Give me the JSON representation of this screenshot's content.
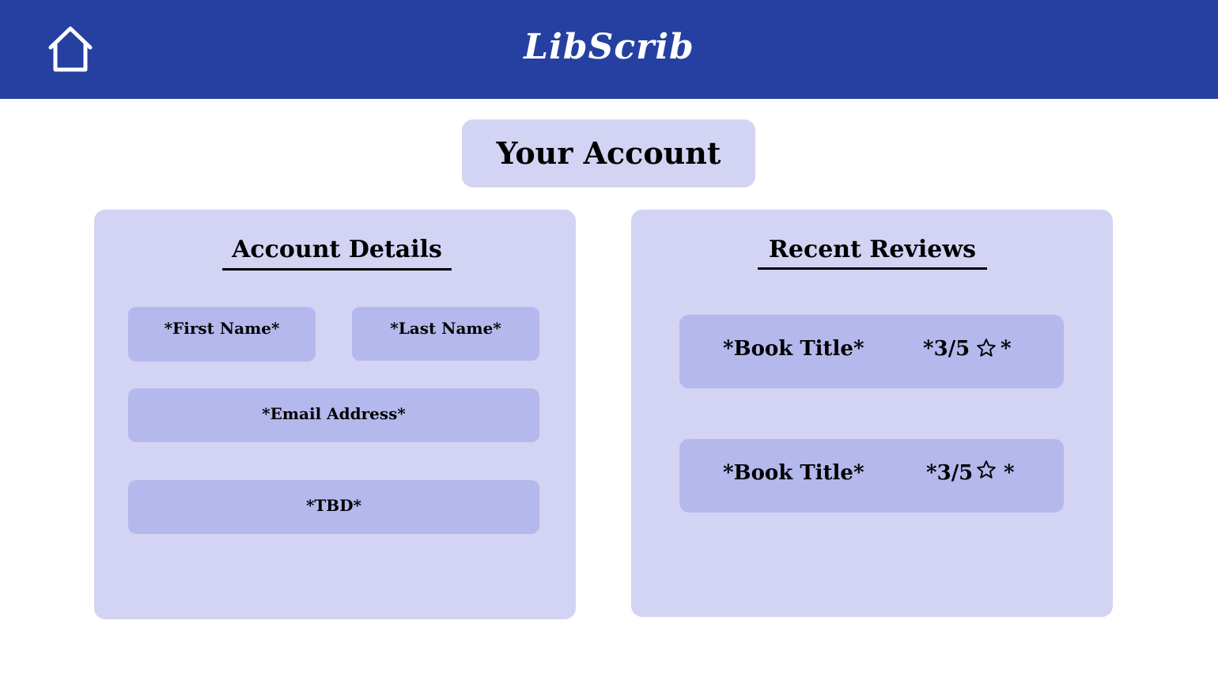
{
  "header": {
    "brand": "LibScrib",
    "home_icon": "home-icon"
  },
  "page": {
    "title": "Your Account"
  },
  "account_details": {
    "heading": "Account Details",
    "first_name": "*First Name*",
    "last_name": "*Last Name*",
    "email": "*Email Address*",
    "tbd": "*TBD*"
  },
  "recent_reviews": {
    "heading": "Recent Reviews",
    "items": [
      {
        "title": "*Book Title*",
        "rating": "*3/5",
        "star_icon": "star-outline-icon",
        "suffix": "*"
      },
      {
        "title": "*Book Title*",
        "rating": "*3/5",
        "star_icon": "star-outline-icon",
        "suffix": "*"
      }
    ]
  },
  "colors": {
    "header_bg": "#2540a0",
    "panel_bg": "#d3d3f3",
    "field_bg": "#b5b8ec"
  }
}
